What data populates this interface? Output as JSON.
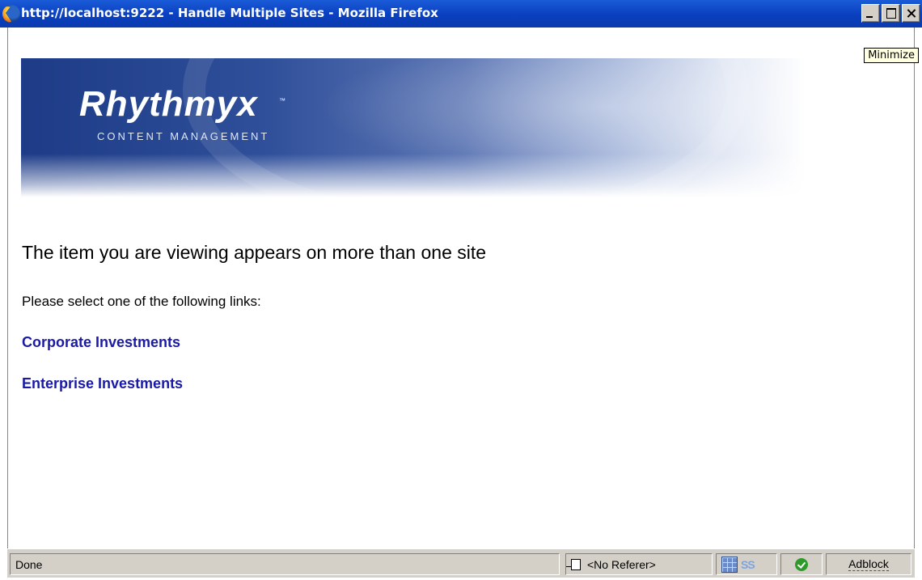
{
  "window": {
    "title": "http://localhost:9222 - Handle Multiple Sites - Mozilla Firefox",
    "tooltip": "Minimize"
  },
  "banner": {
    "logo": "Rhythmyx",
    "logo_tm": "™",
    "subtitle": "CONTENT MANAGEMENT"
  },
  "main": {
    "heading": "The item you are viewing appears on more than one site",
    "prompt": "Please select one of the following links:",
    "links": [
      {
        "label": "Corporate Investments"
      },
      {
        "label": "Enterprise Investments"
      }
    ]
  },
  "statusbar": {
    "status": "Done",
    "referer": "<No Referer>",
    "adblock": "Adblock"
  },
  "colors": {
    "titlebar": "#0a3fbf",
    "link": "#1a1aa6",
    "chrome": "#d4d0c8"
  },
  "icons": [
    "firefox-icon",
    "minimize-icon",
    "maximize-icon",
    "close-icon",
    "referer-page-icon",
    "page-grid-icon",
    "stylesheet-icon",
    "check-icon"
  ]
}
